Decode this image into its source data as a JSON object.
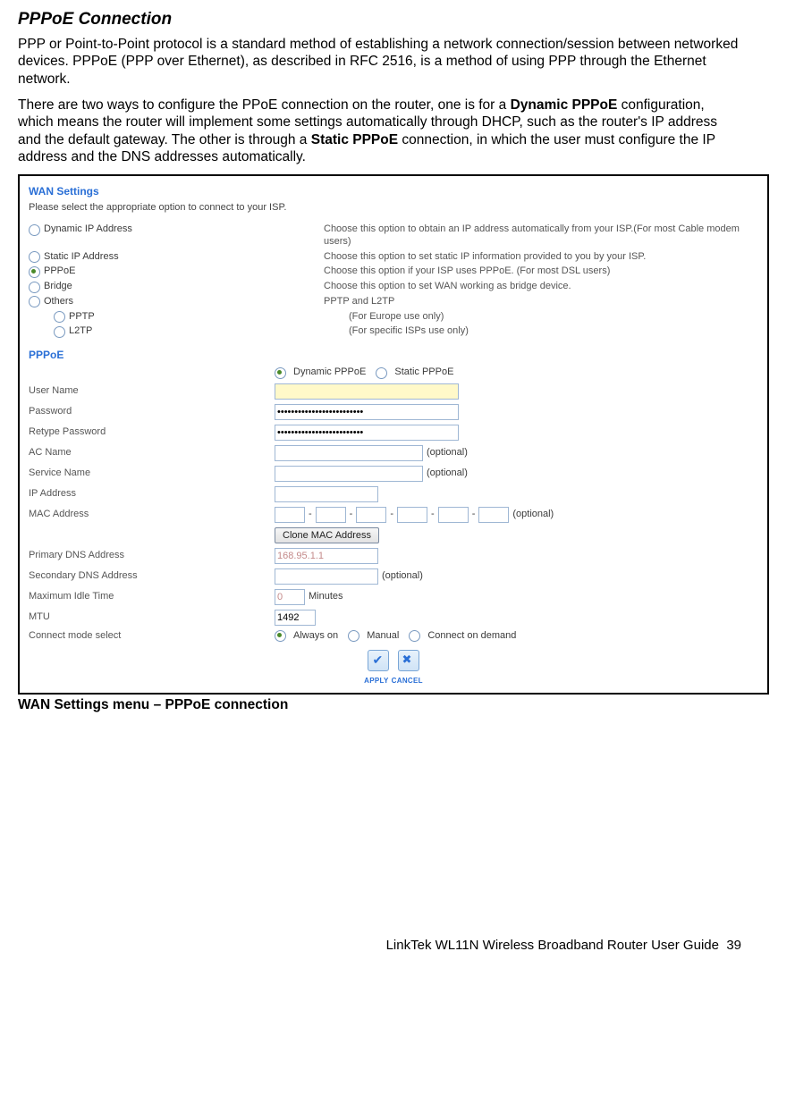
{
  "title": "PPPoE Connection",
  "para1": "PPP or Point-to-Point protocol is a standard method of establishing a network connection/session between networked devices. PPPoE (PPP over Ethernet), as described in RFC 2516, is a method of using PPP through the Ethernet network.",
  "para2_prefix": "There are two ways to configure the PPoE connection on the router, one is for a ",
  "para2_bold1": "Dynamic PPPoE",
  "para2_mid": " configuration, which means the router will implement some settings automatically through DHCP, such as the router's IP address and the default gateway. The other is through a ",
  "para2_bold2": "Static PPPoE",
  "para2_suffix": " connection, in which the user must configure the IP address and the DNS addresses automatically.",
  "figure": {
    "heading": "WAN Settings",
    "sub": "Please select the appropriate option to connect to your ISP.",
    "options": {
      "dynip": {
        "label": "Dynamic IP Address",
        "desc": "Choose this option to obtain an IP address automatically from your ISP.(For most Cable modem users)"
      },
      "staticip": {
        "label": "Static IP Address",
        "desc": "Choose this option to set static IP information provided to you by your ISP."
      },
      "pppoe": {
        "label": "PPPoE",
        "desc": "Choose this option if your ISP uses PPPoE. (For most DSL users)"
      },
      "bridge": {
        "label": "Bridge",
        "desc": "Choose this option to set WAN working as bridge device."
      },
      "others": {
        "label": "Others",
        "desc": "PPTP and L2TP"
      },
      "pptp": {
        "label": "PPTP",
        "desc": "(For Europe use only)"
      },
      "l2tp": {
        "label": "L2TP",
        "desc": "(For specific ISPs use only)"
      }
    },
    "section2": "PPPoE",
    "mode": {
      "dyn": "Dynamic PPPoE",
      "stat": "Static PPPoE"
    },
    "labels": {
      "user": "User Name",
      "pass": "Password",
      "repass": "Retype Password",
      "ac": "AC Name",
      "service": "Service Name",
      "ip": "IP Address",
      "mac": "MAC Address",
      "clone": "Clone MAC Address",
      "pdns": "Primary DNS Address",
      "sdns": "Secondary DNS Address",
      "idle": "Maximum Idle Time",
      "mtu": "MTU",
      "connmode": "Connect mode select",
      "optional": "(optional)",
      "minutes": "Minutes"
    },
    "values": {
      "pass": "•••••••••••••••••••••••••",
      "repass": "•••••••••••••••••••••••••",
      "pdns": "168.95.1.1",
      "idle": "0",
      "mtu": "1492"
    },
    "connmodes": {
      "always": "Always on",
      "manual": "Manual",
      "demand": "Connect on demand"
    },
    "apply": "APPLY",
    "cancel": "CANCEL"
  },
  "caption": "WAN Settings menu – PPPoE connection",
  "footer_text": "LinkTek WL11N Wireless Broadband Router User Guide",
  "footer_page": "39"
}
